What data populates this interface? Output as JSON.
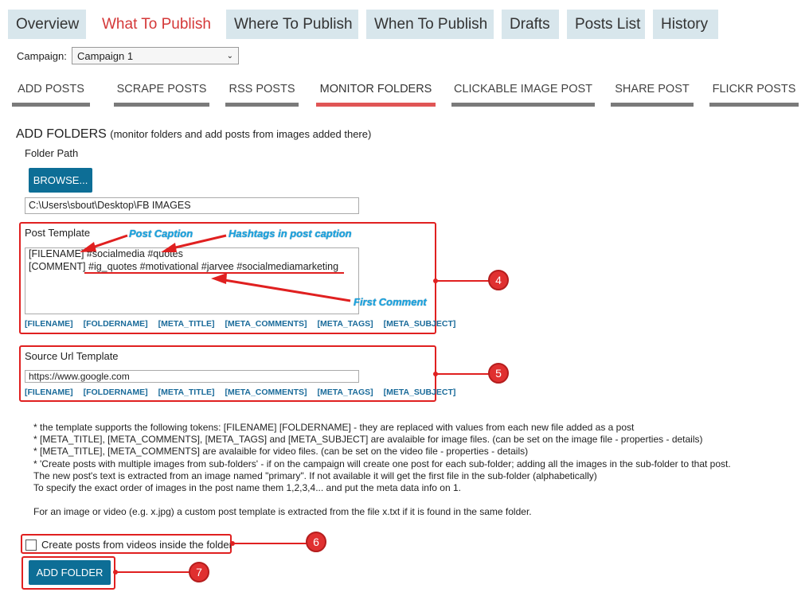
{
  "top_tabs": [
    {
      "label": "Overview",
      "active": false
    },
    {
      "label": "What To Publish",
      "active": true
    },
    {
      "label": "Where To Publish",
      "active": false
    },
    {
      "label": "When To Publish",
      "active": false
    },
    {
      "label": "Drafts",
      "active": false
    },
    {
      "label": "Posts List",
      "active": false
    },
    {
      "label": "History",
      "active": false
    }
  ],
  "campaign": {
    "label": "Campaign:",
    "value": "Campaign 1"
  },
  "sub_tabs": [
    {
      "label": "ADD POSTS",
      "active": false
    },
    {
      "label": "SCRAPE POSTS",
      "active": false
    },
    {
      "label": "RSS POSTS",
      "active": false
    },
    {
      "label": "MONITOR FOLDERS",
      "active": true
    },
    {
      "label": "CLICKABLE IMAGE POST",
      "active": false
    },
    {
      "label": "SHARE POST",
      "active": false
    },
    {
      "label": "FLICKR POSTS",
      "active": false
    }
  ],
  "add_folders": {
    "title": "ADD FOLDERS",
    "subtitle": "(monitor folders and add posts from images added there)",
    "folder_path_label": "Folder Path",
    "browse_label": "BROWSE...",
    "folder_path_value": "C:\\Users\\sbout\\Desktop\\FB IMAGES"
  },
  "post_template": {
    "label": "Post Template",
    "line1": "[FILENAME] #socialmedia #quotes",
    "line2": "[COMMENT] #ig_quotes #motivational #jarvee #socialmediamarketing"
  },
  "source_url": {
    "label": "Source Url Template",
    "value": "https://www.google.com"
  },
  "tokens": [
    "[FILENAME]",
    "[FOLDERNAME]",
    "[META_TITLE]",
    "[META_COMMENTS]",
    "[META_TAGS]",
    "[META_SUBJECT]"
  ],
  "annotations": {
    "post_caption": "Post Caption",
    "hashtags": "Hashtags in post caption",
    "first_comment": "First Comment"
  },
  "callouts": [
    "4",
    "5",
    "6",
    "7"
  ],
  "notes": [
    "* the template supports the following tokens:  [FILENAME]  [FOLDERNAME]  - they are replaced with values from each new file added as a post",
    "* [META_TITLE], [META_COMMENTS], [META_TAGS] and [META_SUBJECT] are avalaible for image files. (can be set on the image file - properties - details)",
    "* [META_TITLE], [META_COMMENTS] are avalaible for video files. (can be set on the video file - properties - details)",
    "* 'Create posts with multiple images from sub-folders' - if on the campaign will create one post for each sub-folder; adding all the images in the sub-folder to that post.",
    "The new post's text is extracted from an image named \"primary\". If not available it will get the first file in the sub-folder (alphabetically)",
    "To specify the exact order of images in the post name them 1,2,3,4...  and put the meta data info on 1.",
    "For an image or video (e.g. x.jpg) a custom post template is extracted from the file x.txt if it is found in the same folder."
  ],
  "videos_checkbox": {
    "label": "Create posts from videos inside the folder",
    "checked": false
  },
  "add_folder_button": "ADD FOLDER",
  "colors": {
    "accent_red": "#e02020",
    "button_blue": "#0d6e96",
    "tab_bg": "#d8e6ec",
    "annotation_blue": "#1aa3e0"
  }
}
